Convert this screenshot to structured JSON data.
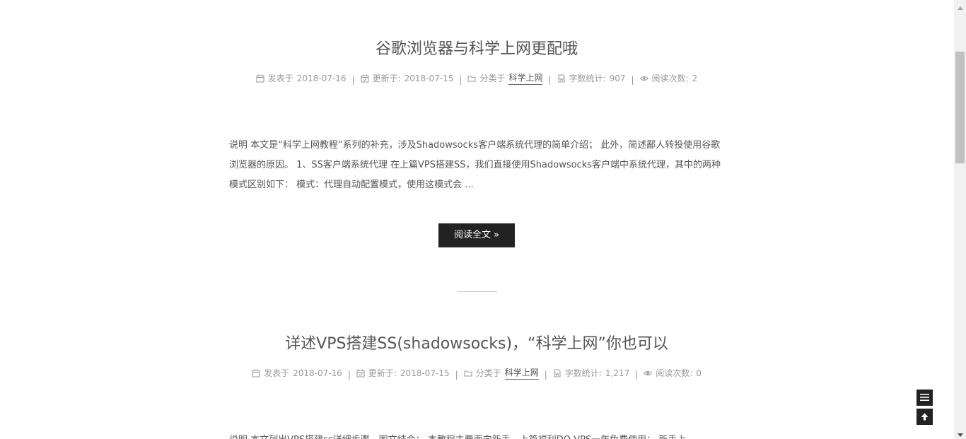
{
  "posts": [
    {
      "title": "谷歌浏览器与科学上网更配哦",
      "meta": {
        "posted_label": "发表于",
        "posted_date": "2018-07-16",
        "updated_label": "更新于:",
        "updated_date": "2018-07-15",
        "category_label": "分类于",
        "category": "科学上网",
        "wordcount_label": "字数统计:",
        "wordcount": "907",
        "views_label": "阅读次数:",
        "views": "2"
      },
      "excerpt": "说明 本文是“科学上网教程”系列的补充，涉及Shadowsocks客户端系统代理的简单介绍； 此外，简述鄙人转投使用谷歌浏览器的原因。 1、SS客户端系统代理 在上篇VPS搭建SS，我们直接使用Shadowsocks客户端中系统代理，其中的两种模式区别如下： 模式：代理自动配置模式，使用这模式会 ...",
      "read_more": "阅读全文 »"
    },
    {
      "title": "详述VPS搭建SS(shadowsocks)，“科学上网”你也可以",
      "meta": {
        "posted_label": "发表于",
        "posted_date": "2018-07-16",
        "updated_label": "更新于:",
        "updated_date": "2018-07-15",
        "category_label": "分类于",
        "category": "科学上网",
        "wordcount_label": "字数统计:",
        "wordcount": "1,217",
        "views_label": "阅读次数:",
        "views": "0"
      },
      "excerpt": "说明 本文列出VPS搭建ss详细步骤，图文结合； 本教程主要面向新手，上篇福利DO VPS一年免费使用； 新手上"
    }
  ],
  "meta_separator": "|",
  "icons": {
    "posted": "calendar-icon",
    "updated": "calendar-check-icon",
    "category": "folder-icon",
    "wordcount": "file-word-icon",
    "views": "eye-icon",
    "menu": "menu-icon",
    "back_to_top": "arrow-up-icon"
  },
  "colors": {
    "text": "#555555",
    "meta": "#999999",
    "button_bg": "#222222",
    "button_text": "#ffffff"
  }
}
